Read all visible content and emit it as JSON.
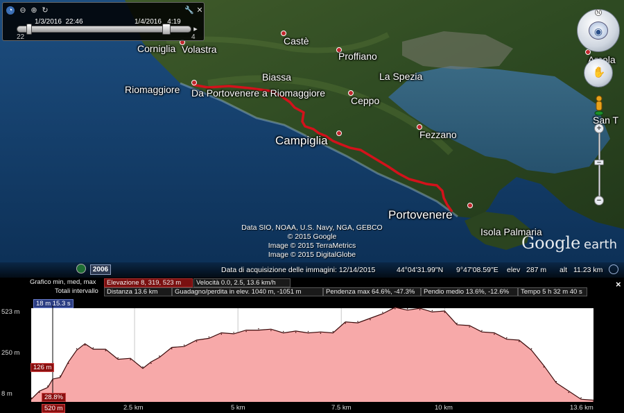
{
  "time_slider": {
    "start_date": "1/3/2016",
    "start_time": "22:46",
    "end_date": "1/4/2016",
    "end_time": "4:19",
    "left_num": "22",
    "right_num": "4"
  },
  "places": {
    "corniglia": "Corniglia",
    "volastra": "Volastra",
    "caste": "Castè",
    "proffiano": "Proffiano",
    "biassa": "Biassa",
    "la_spezia": "La Spezia",
    "riomaggiore": "Riomaggiore",
    "route_name": "Da Portovenere a Riomaggiore",
    "ceppo": "Ceppo",
    "fezzano": "Fezzano",
    "campiglia": "Campiglia",
    "portovenere": "Portovenere",
    "isola_palmaria": "Isola Palmaria",
    "san_t": "San T",
    "arcola": "Arcola"
  },
  "credits": [
    "Data SIO, NOAA, U.S. Navy, NGA, GEBCO",
    "© 2015 Google",
    "Image © 2015 TerraMetrics",
    "Image © 2015 DigitalGlobe"
  ],
  "brand": "Google earth",
  "status": {
    "year": "2006",
    "acquisition": "Data di acquisizione delle immagini: 12/14/2015",
    "lat": "44°04'31.99\"N",
    "lon": "9°47'08.59\"E",
    "elev_label": "elev",
    "elev_value": "287 m",
    "alt_label": "alt",
    "alt_value": "11.23 km"
  },
  "profile": {
    "row1": {
      "graph_label": "Grafico  min, med, max",
      "elevation": "Elevazione  8, 319, 523 m",
      "speed": "Velocità  0.0, 2.5, 13.6 km/h"
    },
    "row2": {
      "totals_label": "Totali intervallo",
      "distance": "Distanza  13.6 km",
      "gain": "Guadagno/perdita in elev.  1040 m, -1051 m",
      "max_slope": "Pendenza max  64.6%, -47.3%",
      "avg_slope": "Pendio medio  13.6%, -12.6%",
      "time": "Tempo  5 h 32 m 40 s"
    },
    "cursor_time": "18 m 15.3 s",
    "cursor_elev": "126 m",
    "cursor_slope": "28.8%",
    "cursor_dist": "520 m",
    "close": "×"
  },
  "chart_data": {
    "type": "area",
    "title": "",
    "xlabel": "",
    "ylabel": "",
    "xlim": [
      0,
      13.6
    ],
    "ylim": [
      8,
      523
    ],
    "yticks": [
      "523 m",
      "250 m",
      "8 m"
    ],
    "xticks": [
      "2.5 km",
      "5 km",
      "7.5 km",
      "10 km",
      "13.6 km"
    ],
    "x": [
      0,
      0.2,
      0.4,
      0.52,
      0.7,
      0.9,
      1.1,
      1.3,
      1.5,
      1.8,
      2.1,
      2.4,
      2.7,
      2.9,
      3.1,
      3.4,
      3.7,
      4.0,
      4.3,
      4.6,
      4.9,
      5.2,
      5.5,
      5.8,
      6.1,
      6.4,
      6.7,
      7.0,
      7.3,
      7.6,
      7.9,
      8.2,
      8.5,
      8.8,
      9.1,
      9.4,
      9.7,
      10.0,
      10.3,
      10.6,
      10.9,
      11.2,
      11.5,
      11.8,
      12.1,
      12.4,
      12.7,
      13.0,
      13.3,
      13.6
    ],
    "y": [
      30,
      60,
      95,
      126,
      150,
      220,
      300,
      320,
      305,
      290,
      250,
      240,
      200,
      220,
      260,
      300,
      320,
      340,
      365,
      380,
      390,
      395,
      410,
      400,
      395,
      390,
      395,
      385,
      395,
      440,
      450,
      460,
      500,
      520,
      520,
      515,
      510,
      500,
      440,
      420,
      400,
      380,
      360,
      340,
      300,
      200,
      120,
      60,
      30,
      10
    ],
    "grid": true,
    "fill_color": "#f7a9a9",
    "line_color": "#3a0a0a",
    "cursor_x": 0.52
  }
}
